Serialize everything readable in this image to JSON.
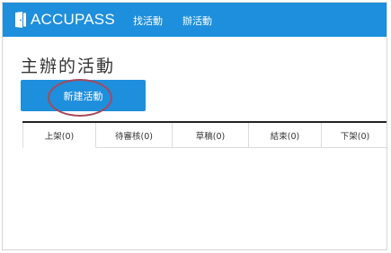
{
  "brand": {
    "logo_text": "ACCUPASS",
    "logo_icon": "door-icon",
    "color": "#1e8fdc"
  },
  "nav": {
    "find_event": "找活動",
    "host_event": "辦活動"
  },
  "page": {
    "title": "主辦的活動",
    "new_event_button": "新建活動"
  },
  "annotation": {
    "color": "#a8485a"
  },
  "tabs": [
    {
      "label": "上架(0)",
      "active": true
    },
    {
      "label": "待審核(0)",
      "active": false
    },
    {
      "label": "草稿(0)",
      "active": false
    },
    {
      "label": "結束(0)",
      "active": false
    },
    {
      "label": "下架(0)",
      "active": false
    }
  ]
}
